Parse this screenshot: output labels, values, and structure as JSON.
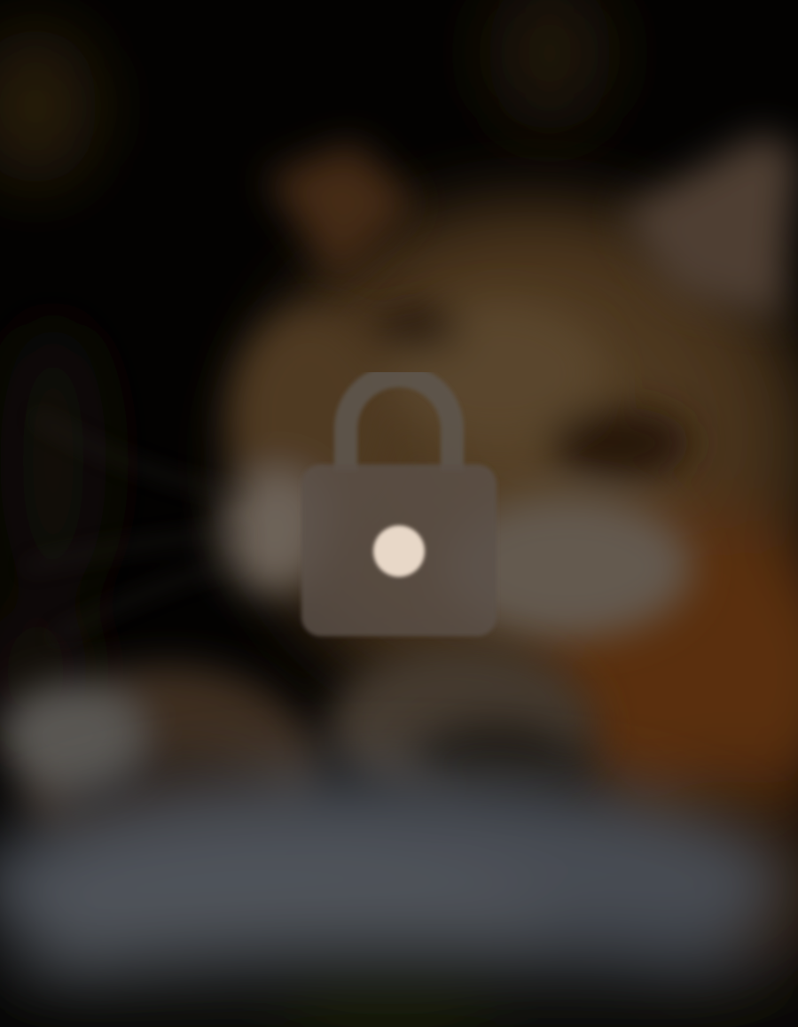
{
  "wallpaper": {
    "icon": "blurred-sleeping-cat-photo"
  },
  "lock": {
    "icon": "padlock-icon",
    "state": "locked"
  },
  "colors": {
    "overlay": "#000000",
    "lock_fill": "#5a5048",
    "lock_shackle": "#5e564e",
    "keyhole": "#e8d8c8"
  }
}
